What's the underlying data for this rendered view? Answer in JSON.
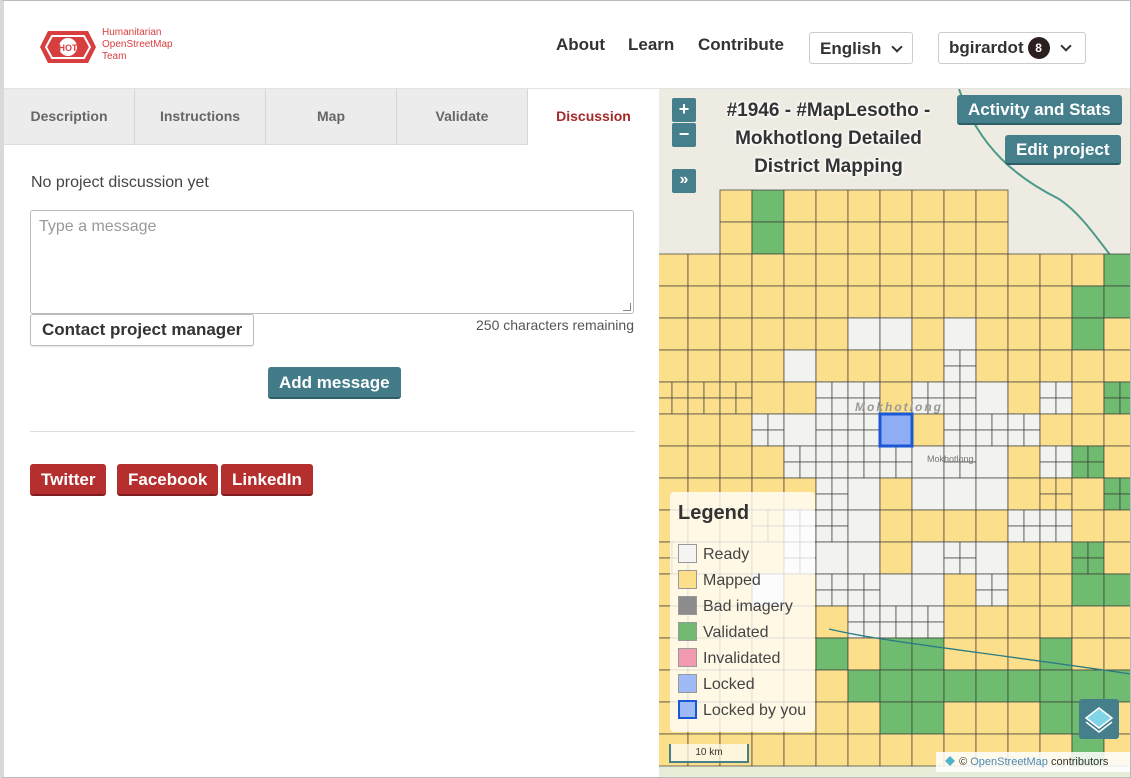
{
  "header": {
    "logo_text": [
      "Humanitarian",
      "OpenStreetMap",
      "Team"
    ],
    "logo_badge": "HOT",
    "nav": [
      "About",
      "Learn",
      "Contribute"
    ],
    "language": "English",
    "user": "bgirardot",
    "notifications": "8"
  },
  "tabs": [
    "Description",
    "Instructions",
    "Map",
    "Validate",
    "Discussion"
  ],
  "active_tab": "Discussion",
  "discussion": {
    "empty_text": "No project discussion yet",
    "placeholder": "Type a message",
    "contact_button": "Contact project manager",
    "chars_remaining": "250 characters remaining",
    "add_button": "Add message"
  },
  "social": [
    "Twitter",
    "Facebook",
    "LinkedIn"
  ],
  "map": {
    "title": "#1946 - #MapLesotho - Mokhotlong Detailed District Mapping",
    "activity_button": "Activity and Stats",
    "edit_button": "Edit project",
    "zoom_in": "+",
    "zoom_out": "−",
    "expand": "»",
    "place_label_large": "Mokhotlong",
    "place_label_small": "Mokhotlong",
    "scale": "10 km",
    "attribution_prefix": "©",
    "attribution_link": "OpenStreetMap",
    "attribution_suffix": "contributors",
    "colors": {
      "ready": "#f2f2ef",
      "mapped": "#fcdf8b",
      "bad": "#888888",
      "validated": "#6fbb6f",
      "invalidated": "#f28ea5",
      "locked": "#9dbaf5",
      "locked_by_you": "#8faef5"
    },
    "legend": {
      "title": "Legend",
      "items": [
        {
          "label": "Ready",
          "color": "#f4f4f2",
          "border": "#999999"
        },
        {
          "label": "Mapped",
          "color": "#fcdf8b",
          "border": "#999999"
        },
        {
          "label": "Bad imagery",
          "color": "#8c8c8c",
          "border": "#999999"
        },
        {
          "label": "Validated",
          "color": "#71b871",
          "border": "#999999"
        },
        {
          "label": "Invalidated",
          "color": "#f29bb0",
          "border": "#999999"
        },
        {
          "label": "Locked",
          "color": "#9fbaf5",
          "border": "#999999"
        },
        {
          "label": "Locked by you",
          "color": "#9fbaf5",
          "border": "#1a57d6"
        }
      ]
    }
  }
}
